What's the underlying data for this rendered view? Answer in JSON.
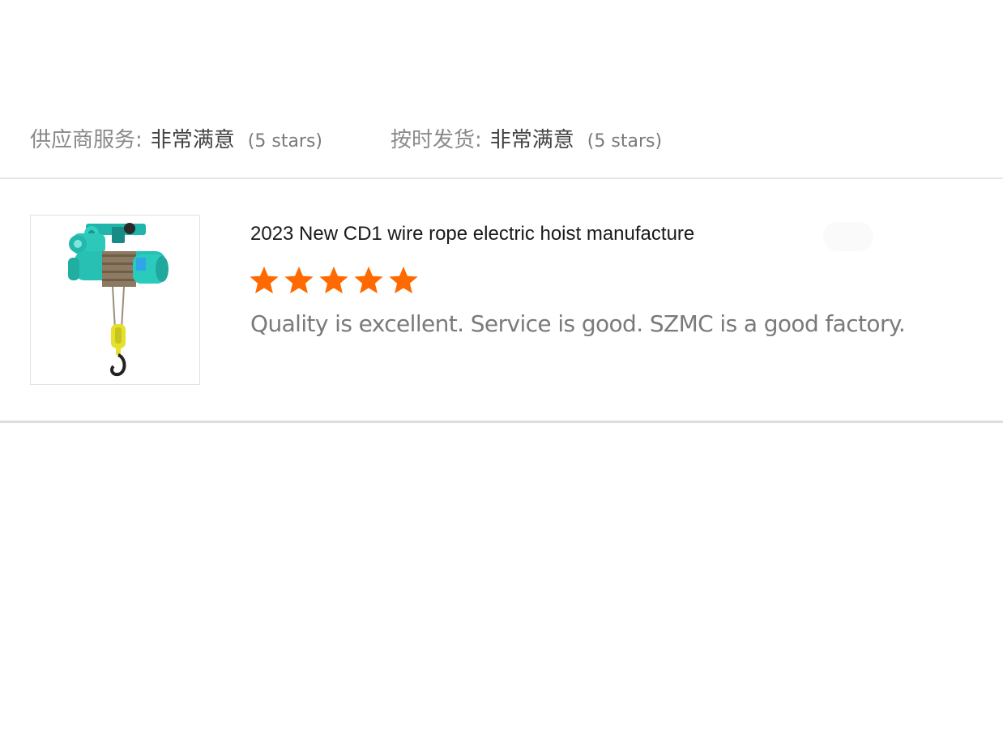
{
  "ratings": [
    {
      "label": "供应商服务:",
      "value": "非常满意",
      "stars": "(5 stars)"
    },
    {
      "label": "按时发货:",
      "value": "非常满意",
      "stars": "(5 stars)"
    }
  ],
  "review": {
    "product_image": "electric-wire-rope-hoist",
    "product_title": "2023 New CD1 wire rope electric hoist manufacture",
    "star_rating": 5,
    "star_max": 5,
    "star_color": "#ff6a00",
    "text": "Quality is excellent. Service is good. SZMC is a good factory."
  }
}
